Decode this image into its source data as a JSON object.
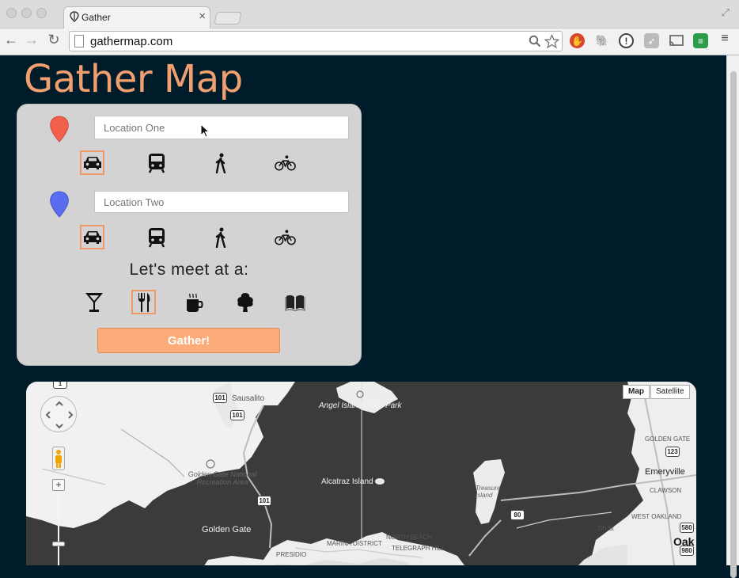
{
  "browser": {
    "tab_title": "Gather",
    "tab_close": "×",
    "url": "gathermap.com",
    "nav": {
      "back": "←",
      "forward": "→",
      "reload": "↻"
    }
  },
  "app": {
    "title": "Gather Map",
    "location_one": {
      "placeholder": "Location One",
      "value": "",
      "pin_color": "#f2604c",
      "selected_mode": "car"
    },
    "location_two": {
      "placeholder": "Location Two",
      "value": "",
      "pin_color": "#5a6cf0",
      "selected_mode": "car"
    },
    "travel_modes": [
      "car-icon",
      "transit-icon",
      "walk-icon",
      "bike-icon"
    ],
    "meet_label": "Let's meet at a:",
    "venue_types": [
      "bar-icon",
      "restaurant-icon",
      "cafe-icon",
      "park-icon",
      "library-icon"
    ],
    "selected_venue": "restaurant",
    "gather_button": "Gather!",
    "accent_color": "#fbac78",
    "title_color": "#f0a06e"
  },
  "map": {
    "type_buttons": {
      "map": "Map",
      "satellite": "Satellite",
      "active": "Map"
    },
    "zoom_in": "+",
    "zoom_out": "−",
    "labels": {
      "sausalito": "Sausalito",
      "angel_island": "Angel Island State Park",
      "ggnra": "Golden Gate National Recreation Area",
      "alcatraz": "Alcatraz Island",
      "golden_gate": "Golden Gate",
      "marina": "MARINA DISTRICT",
      "north_beach": "NORTH BEACH",
      "telegraph": "TELEGRAPH HILL",
      "presidio": "PRESIDIO",
      "treasure": "Treasure Island",
      "golden_gate_ne": "GOLDEN GATE",
      "emeryville": "Emeryville",
      "clawson": "CLAWSON",
      "west_oakland": "WEST OAKLAND",
      "street_7th": "7th St",
      "oakland": "Oak"
    },
    "shields": [
      "1",
      "101",
      "101",
      "101",
      "80",
      "123",
      "580",
      "980"
    ]
  }
}
